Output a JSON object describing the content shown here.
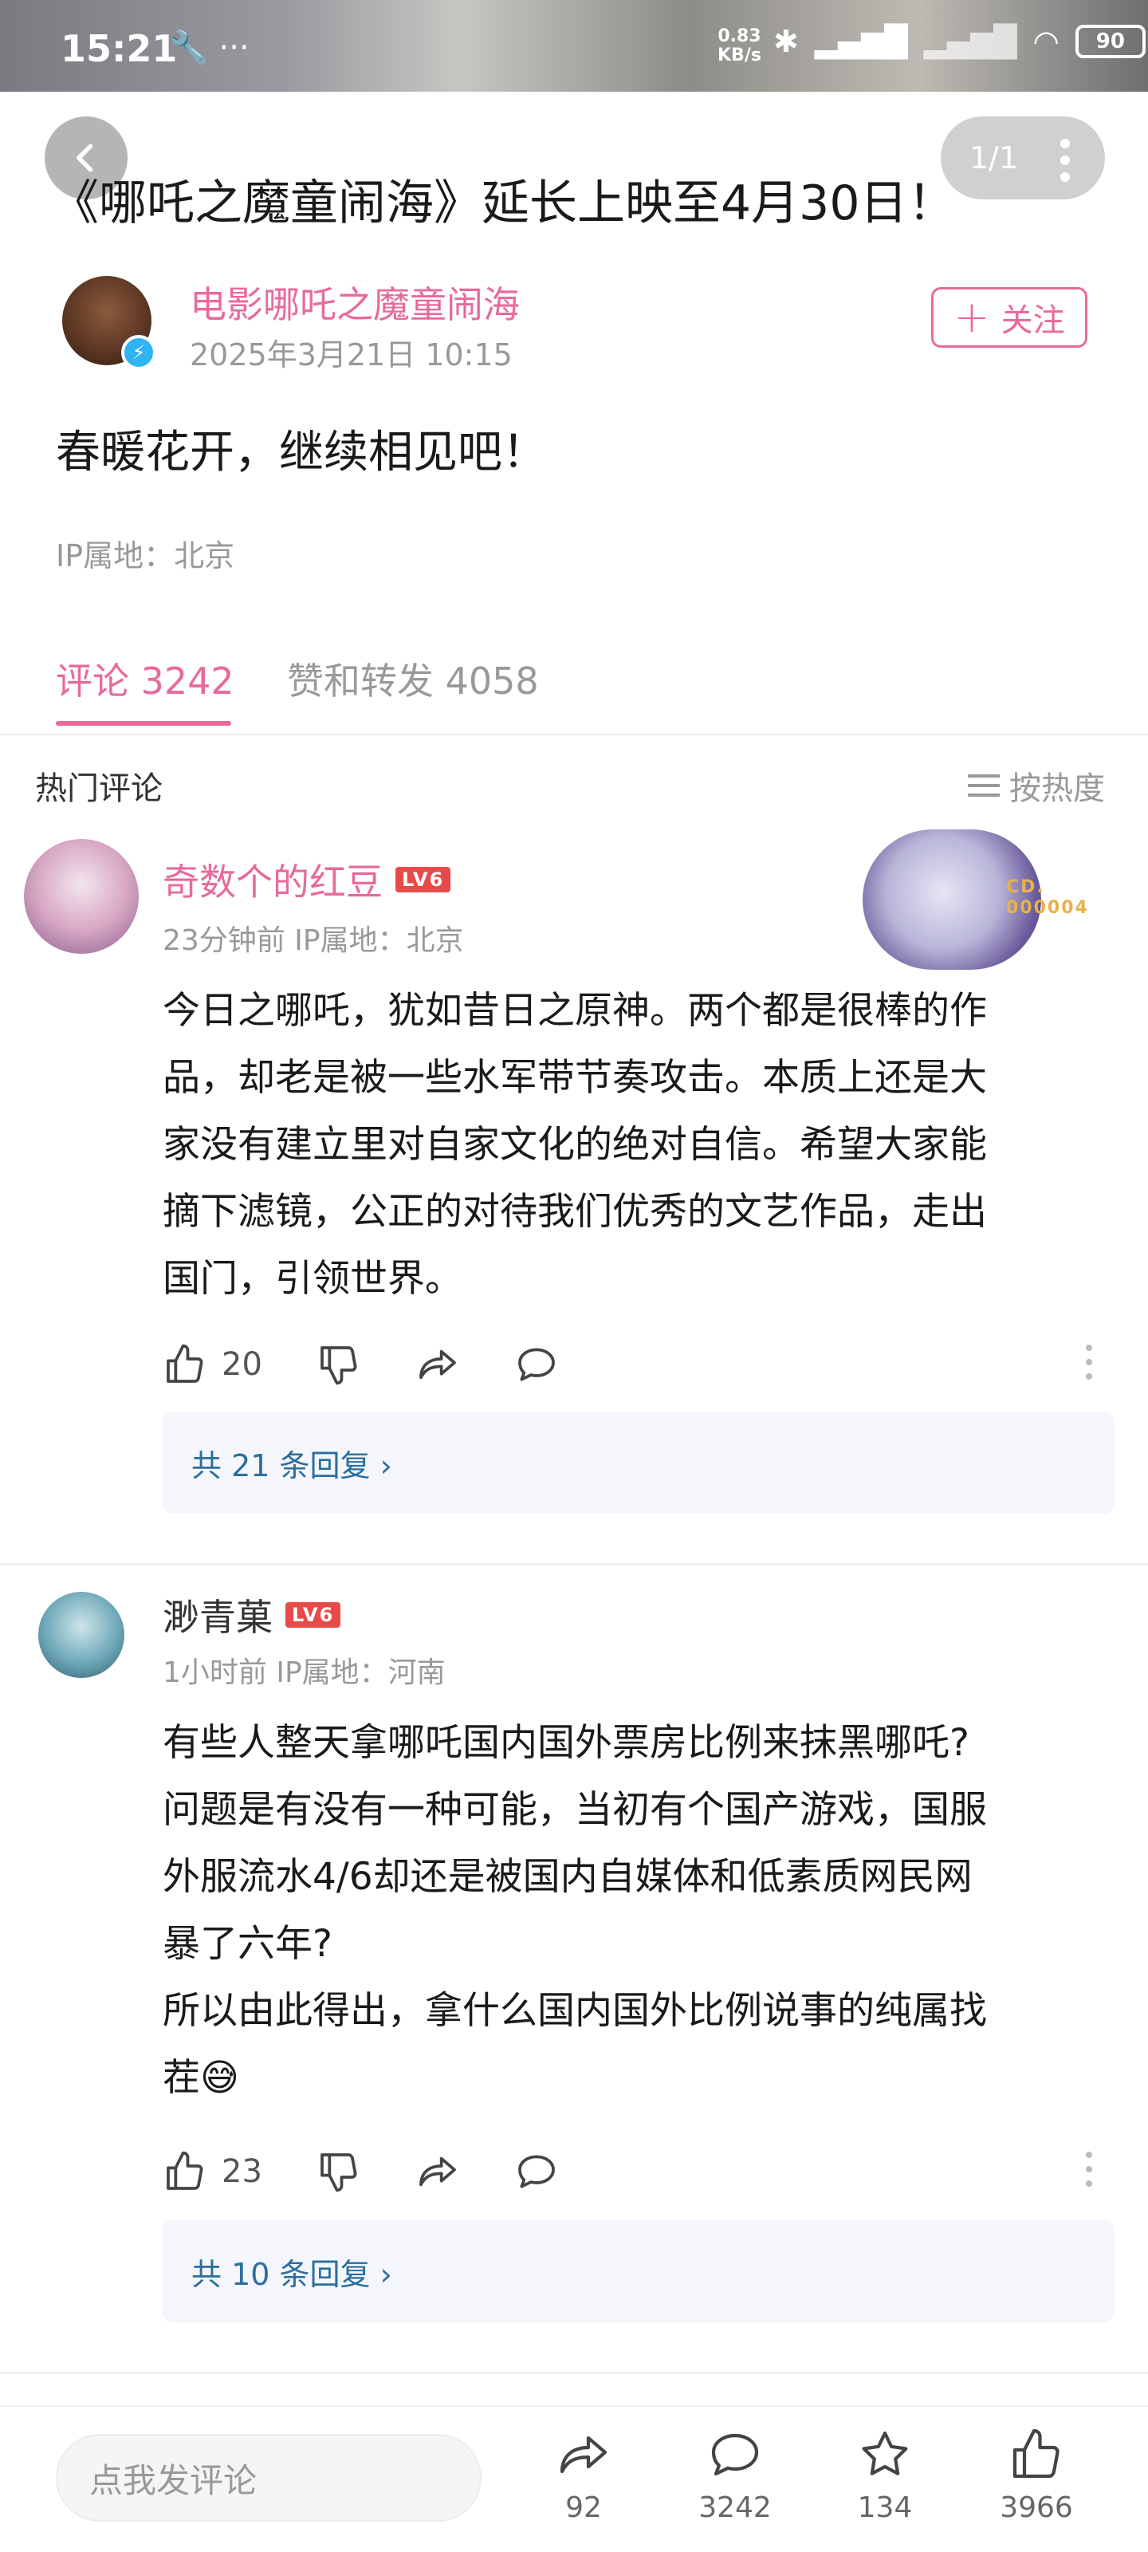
{
  "status_bar": {
    "time": "15:21",
    "left_icons": "🔧 ···",
    "speed_value": "0.83",
    "speed_unit": "KB/s",
    "battery": "90"
  },
  "header": {
    "page_indicator": "1/1"
  },
  "post": {
    "title": "《哪吒之魔童闹海》延长上映至4月30日！",
    "author": "电影哪吒之魔童闹海",
    "time": "2025年3月21日 10:15",
    "follow_label": "关注",
    "body": "春暖花开，继续相见吧！",
    "ip": "IP属地：北京"
  },
  "tabs": [
    {
      "label": "评论 3242"
    },
    {
      "label": "赞和转发 4058"
    }
  ],
  "hot": {
    "title": "热门评论",
    "sort_label": "按热度"
  },
  "comments": [
    {
      "name": "奇数个的红豆",
      "level": "LV6",
      "meta": "23分钟前 IP属地：北京",
      "badge_text": "CD.\n000004",
      "text": "今日之哪吒，犹如昔日之原神。两个都是很棒的作\n品，却老是被一些水军带节奏攻击。本质上还是大\n家没有建立里对自家文化的绝对自信。希望大家能\n摘下滤镜，公正的对待我们优秀的文艺作品，走出\n国门，引领世界。",
      "likes": "20",
      "replies": "共 21 条回复 ›"
    },
    {
      "name": "渺青菓",
      "level": "LV6",
      "meta": "1小时前 IP属地：河南",
      "text": "有些人整天拿哪吒国内国外票房比例来抹黑哪吒?\n问题是有没有一种可能，当初有个国产游戏，国服\n外服流水4/6却还是被国内自媒体和低素质网民网\n暴了六年?\n所以由此得出，拿什么国内国外比例说事的纯属找\n茬😅",
      "likes": "23",
      "replies": "共 10 条回复 ›"
    }
  ],
  "bottom_bar": {
    "input_placeholder": "点我发评论",
    "share_count": "92",
    "comment_count": "3242",
    "star_count": "134",
    "like_count": "3966"
  },
  "colors": {
    "accent": "#e86a9c",
    "reply_link": "#2b6ea0",
    "level_badge": "#e84a4a"
  }
}
